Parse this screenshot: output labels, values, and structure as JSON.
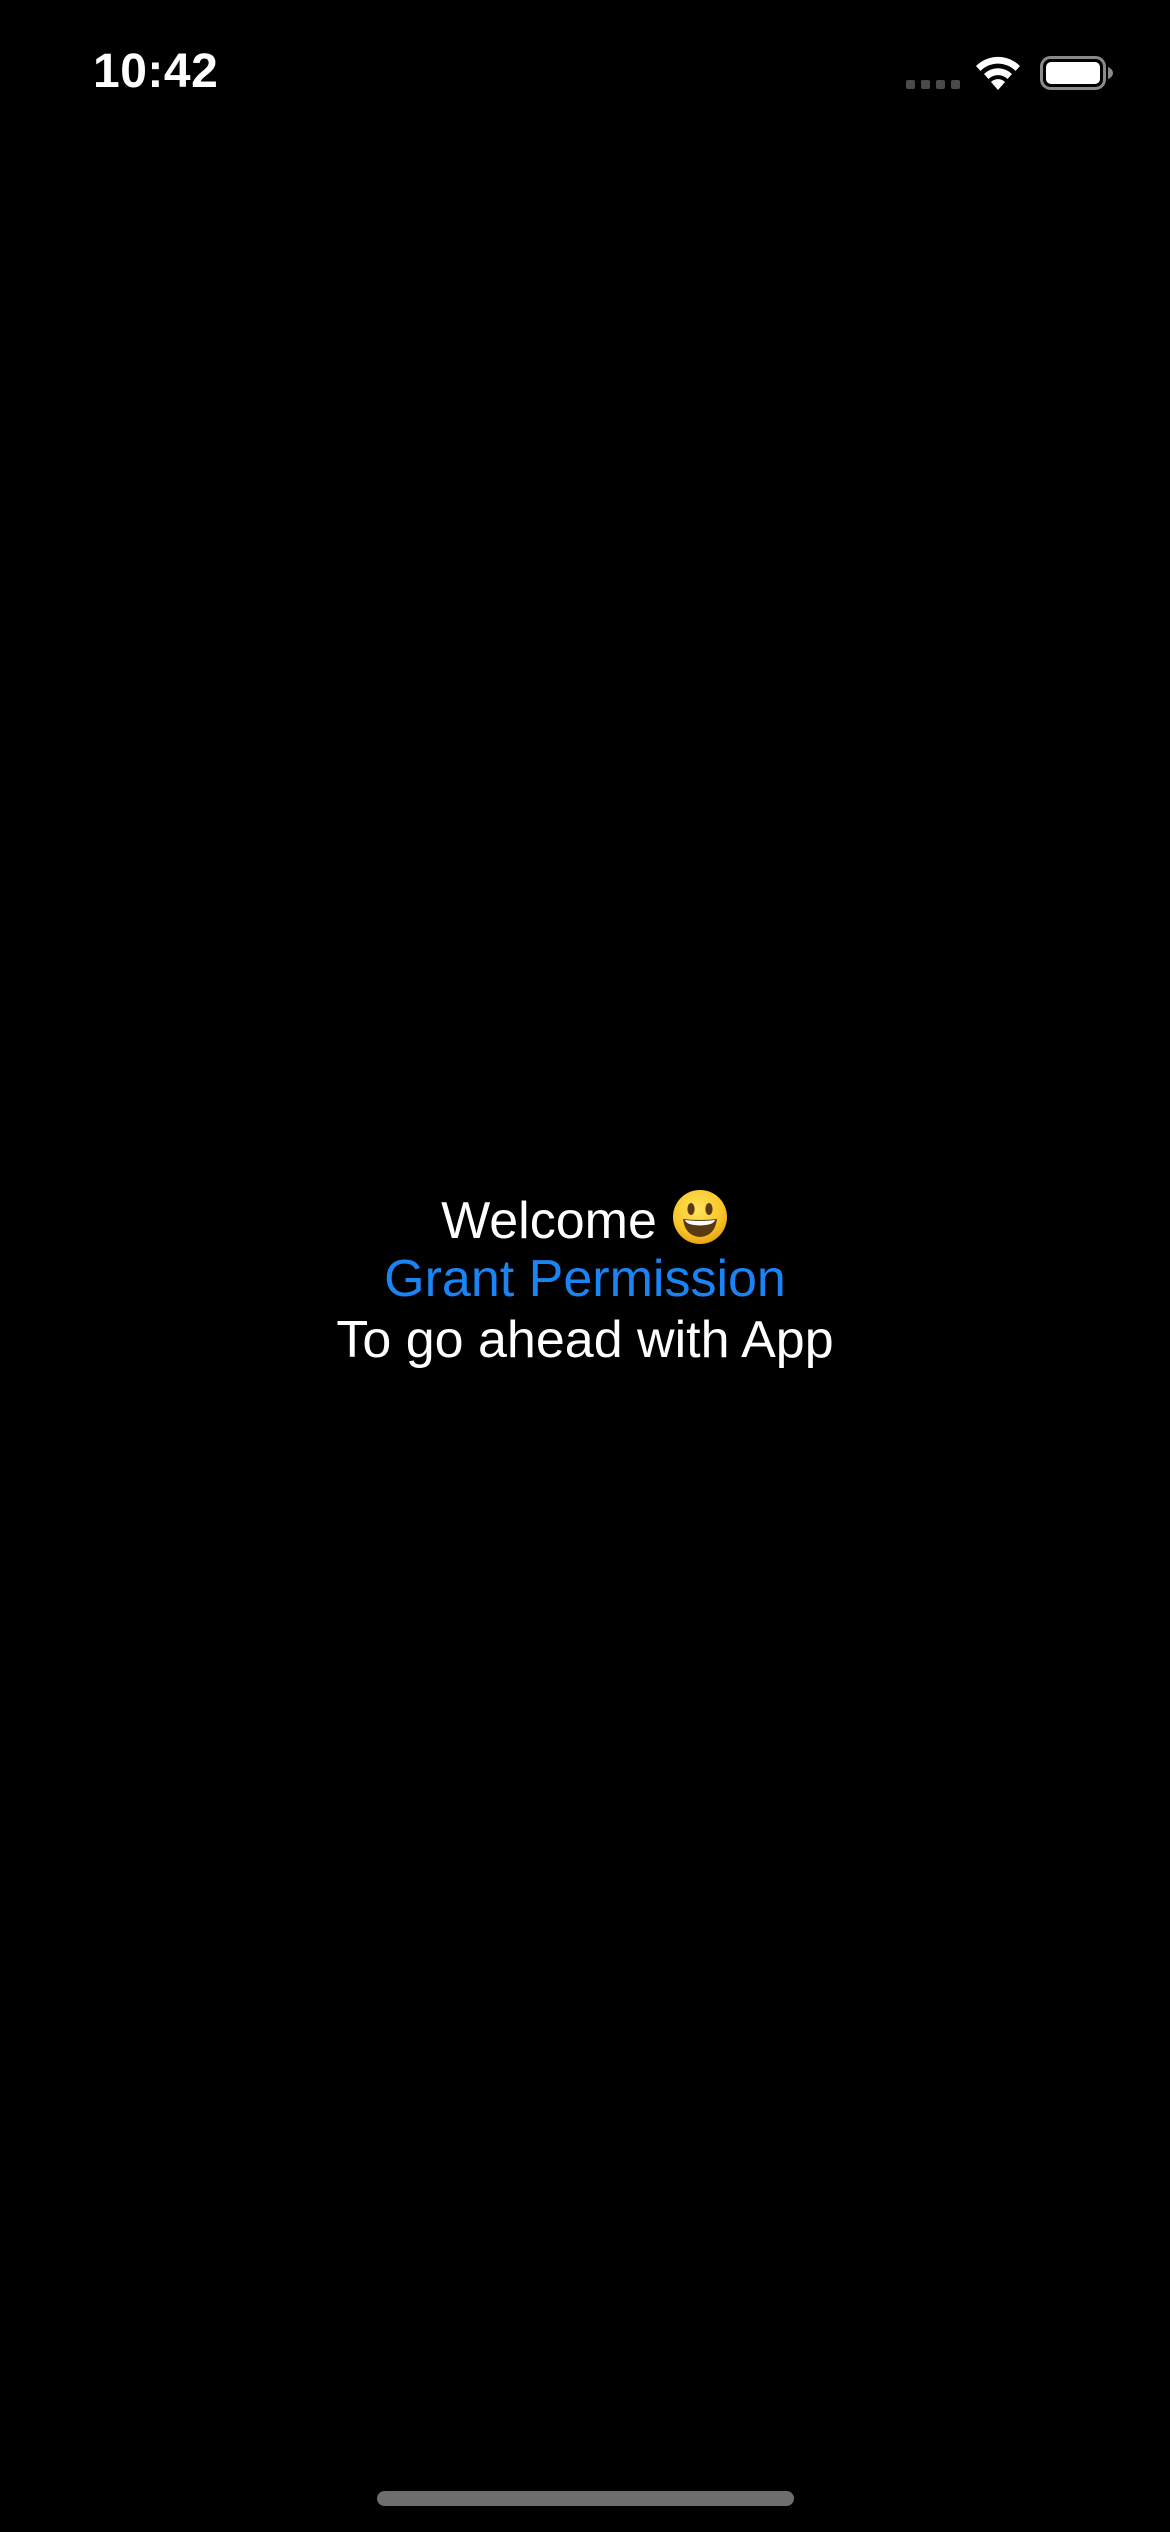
{
  "status_bar": {
    "time": "10:42",
    "signal_icon": "cellular-signal-icon",
    "wifi_icon": "wifi-icon",
    "battery_icon": "battery-icon"
  },
  "main": {
    "welcome_text": "Welcome",
    "welcome_emoji_icon": "smiley-face-icon",
    "grant_permission_label": "Grant Permission",
    "subtitle": "To go ahead with App"
  },
  "colors": {
    "background": "#000000",
    "text": "#ffffff",
    "link": "#1a84f5"
  }
}
